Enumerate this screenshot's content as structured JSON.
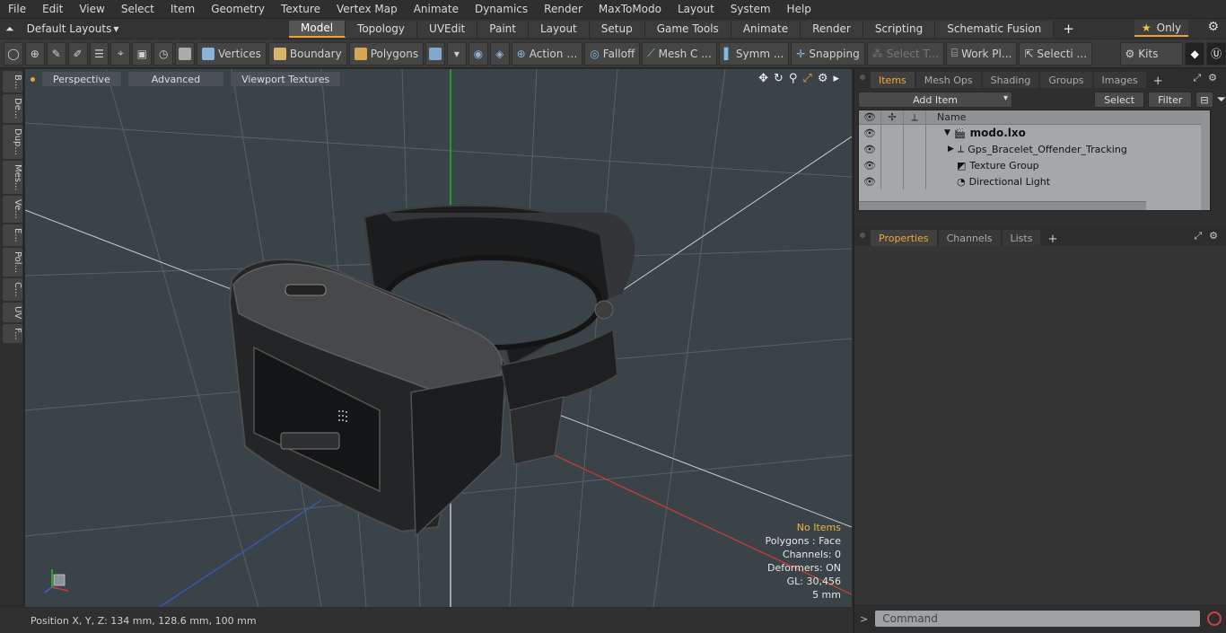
{
  "menu": [
    "File",
    "Edit",
    "View",
    "Select",
    "Item",
    "Geometry",
    "Texture",
    "Vertex Map",
    "Animate",
    "Dynamics",
    "Render",
    "MaxToModo",
    "Layout",
    "System",
    "Help"
  ],
  "layout_select": "Default Layouts",
  "layout_tabs": [
    {
      "label": "Model",
      "active": true
    },
    {
      "label": "Topology",
      "active": false
    },
    {
      "label": "UVEdit",
      "active": false
    },
    {
      "label": "Paint",
      "active": false
    },
    {
      "label": "Layout",
      "active": false
    },
    {
      "label": "Setup",
      "active": false
    },
    {
      "label": "Game Tools",
      "active": false
    },
    {
      "label": "Animate",
      "active": false
    },
    {
      "label": "Render",
      "active": false
    },
    {
      "label": "Scripting",
      "active": false
    },
    {
      "label": "Schematic Fusion",
      "active": false
    }
  ],
  "only_label": "Only",
  "toolbar": {
    "vertices": "Vertices",
    "boundary": "Boundary",
    "polygons": "Polygons",
    "action": "Action",
    "falloff": "Falloff",
    "mesh": "Mesh C ...",
    "symm": "Symm ...",
    "snapping": "Snapping",
    "select_t": "Select T...",
    "work_pl": "Work Pl...",
    "selecti": "Selecti ...",
    "kits": "Kits"
  },
  "left_tabs": [
    "B...",
    "De...",
    "Dup...",
    "Mes...",
    "Ve...",
    "E...",
    "Pol...",
    "C...",
    "UV",
    "F..."
  ],
  "viewport": {
    "perspective": "Perspective",
    "advanced": "Advanced",
    "textures": "Viewport Textures",
    "hud": {
      "title": "No Items",
      "polygons": "Polygons : Face",
      "channels": "Channels: 0",
      "deformers": "Deformers: ON",
      "gl": "GL: 30,456",
      "scale": "5 mm"
    }
  },
  "status": "Position X, Y, Z:   134 mm, 128.6 mm, 100 mm",
  "panel_tabs": [
    {
      "label": "Items",
      "active": true
    },
    {
      "label": "Mesh Ops",
      "active": false
    },
    {
      "label": "Shading",
      "active": false
    },
    {
      "label": "Groups",
      "active": false
    },
    {
      "label": "Images",
      "active": false
    }
  ],
  "add_item": "Add Item",
  "select_btn": "Select",
  "filter_btn": "Filter",
  "tree": {
    "name_header": "Name",
    "rows": [
      {
        "label": "modo.lxo",
        "bold": true
      },
      {
        "label": "Gps_Bracelet_Offender_Tracking",
        "bold": false
      },
      {
        "label": "Texture Group",
        "bold": false
      },
      {
        "label": "Directional Light",
        "bold": false
      }
    ]
  },
  "props_tabs": [
    {
      "label": "Properties",
      "active": true
    },
    {
      "label": "Channels",
      "active": false
    },
    {
      "label": "Lists",
      "active": false
    }
  ],
  "command_placeholder": "Command",
  "colors": {
    "accent": "#e8a23a",
    "viewport_bg": "#3a4347",
    "hud_title": "#f0b53b"
  }
}
